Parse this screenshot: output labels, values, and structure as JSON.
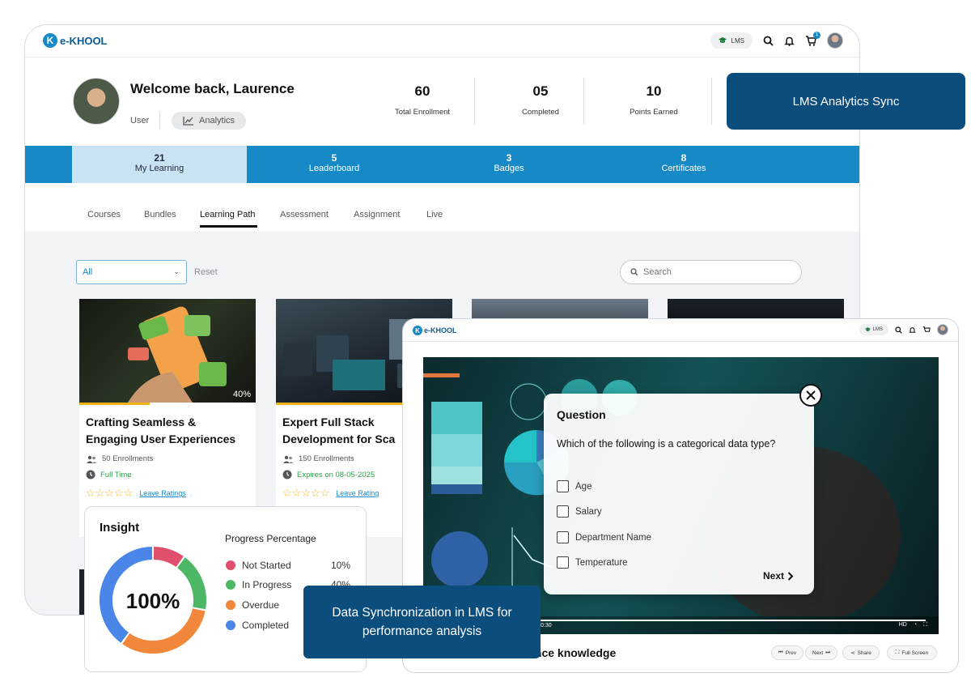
{
  "brand": {
    "name": "e-KHOOL",
    "mark": "K"
  },
  "topbar": {
    "lms_label": "LMS",
    "cart_count": "1"
  },
  "profile": {
    "welcome": "Welcome back, Laurence",
    "role": "User",
    "analytics": "Analytics"
  },
  "stats": [
    {
      "num": "60",
      "label": "Total Enrollment"
    },
    {
      "num": "05",
      "label": "Completed"
    },
    {
      "num": "10",
      "label": "Points Earned"
    }
  ],
  "main_tabs": [
    {
      "count": "21",
      "label": "My Learning"
    },
    {
      "count": "5",
      "label": "Leaderboard"
    },
    {
      "count": "3",
      "label": "Badges"
    },
    {
      "count": "8",
      "label": "Certificates"
    }
  ],
  "sub_tabs": [
    "Courses",
    "Bundles",
    "Learning Path",
    "Assessment",
    "Assignment",
    "Live"
  ],
  "filter": {
    "selected": "All",
    "reset": "Reset",
    "search_placeholder": "Search"
  },
  "cards": [
    {
      "title1": "Crafting Seamless &",
      "title2": "Engaging User Experiences",
      "progress_label": "40%",
      "progress": 0.4,
      "enrollments": "50 Enrollments",
      "status": "Full Time",
      "ratings": "Leave Ratings"
    },
    {
      "title1": "Expert Full Stack",
      "title2": "Development for Sca",
      "enrollments": "150 Enrollments",
      "status": "Expires on 08-05-2025",
      "ratings": "Leave Rating"
    }
  ],
  "overlay_sync": "LMS Analytics Sync",
  "video": {
    "time": "0:30",
    "title": "nhance knowledge",
    "prev": "Prev",
    "next": "Next",
    "share": "Share",
    "fullscreen": "Full Screen",
    "hd": "HD"
  },
  "quiz": {
    "heading": "Question",
    "question": "Which of the following is a categorical data type?",
    "options": [
      "Age",
      "Salary",
      "Department Name",
      "Temperature"
    ],
    "next": "Next"
  },
  "insight": {
    "title": "Insight",
    "center": "100%",
    "progress_title": "Progress Percentage",
    "legend": [
      {
        "label": "Not Started",
        "value": "10%",
        "pct": 10,
        "color": "#e04f6c"
      },
      {
        "label": "In Progress",
        "value": "40%",
        "pct": 18,
        "color": "#4cb865"
      },
      {
        "label": "Overdue",
        "value": "",
        "pct": 32,
        "color": "#f0873a"
      },
      {
        "label": "Completed",
        "value": "",
        "pct": 40,
        "color": "#4a86e8"
      }
    ]
  },
  "overlay_datasync": {
    "line1": "Data Synchronization in LMS for",
    "line2": "performance analysis"
  },
  "colors": {
    "primary": "#1689c6",
    "navy": "#0b4d7d",
    "accent": "#f1b219",
    "green": "#2fa14b"
  }
}
